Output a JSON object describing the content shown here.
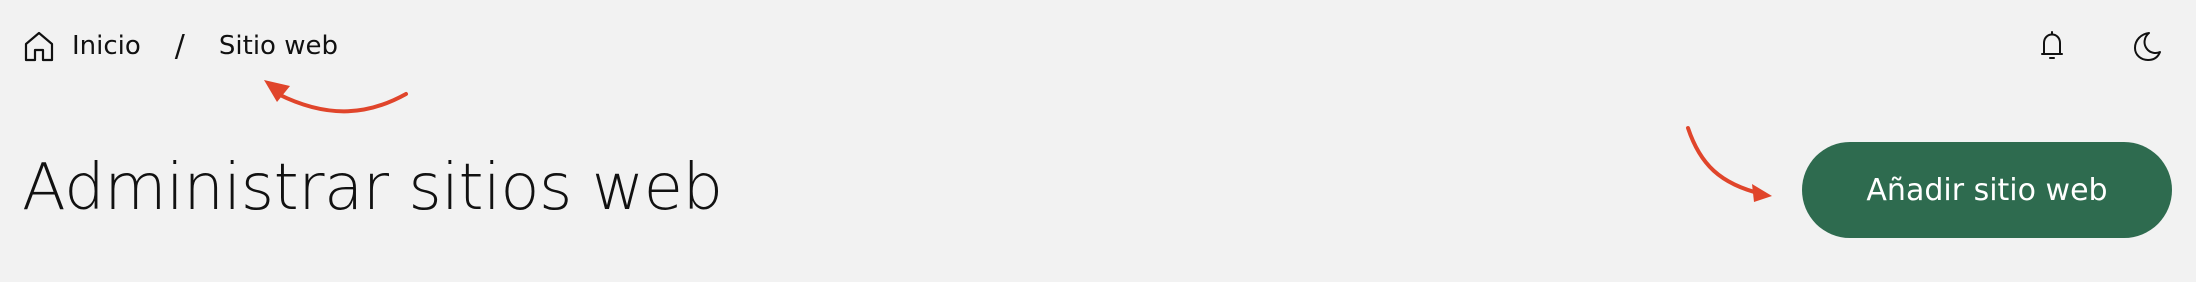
{
  "breadcrumb": {
    "home_icon": "home-icon",
    "home_label": "Inicio",
    "separator": "/",
    "current_label": "Sitio web"
  },
  "header_icons": {
    "notifications": "bell-icon",
    "theme_toggle": "moon-icon"
  },
  "page": {
    "title": "Administrar sitios web",
    "add_button_label": "Añadir sitio web"
  },
  "colors": {
    "background": "#f2f2f2",
    "primary_button": "#2e6b4f",
    "annotation_arrow": "#e0452b"
  }
}
